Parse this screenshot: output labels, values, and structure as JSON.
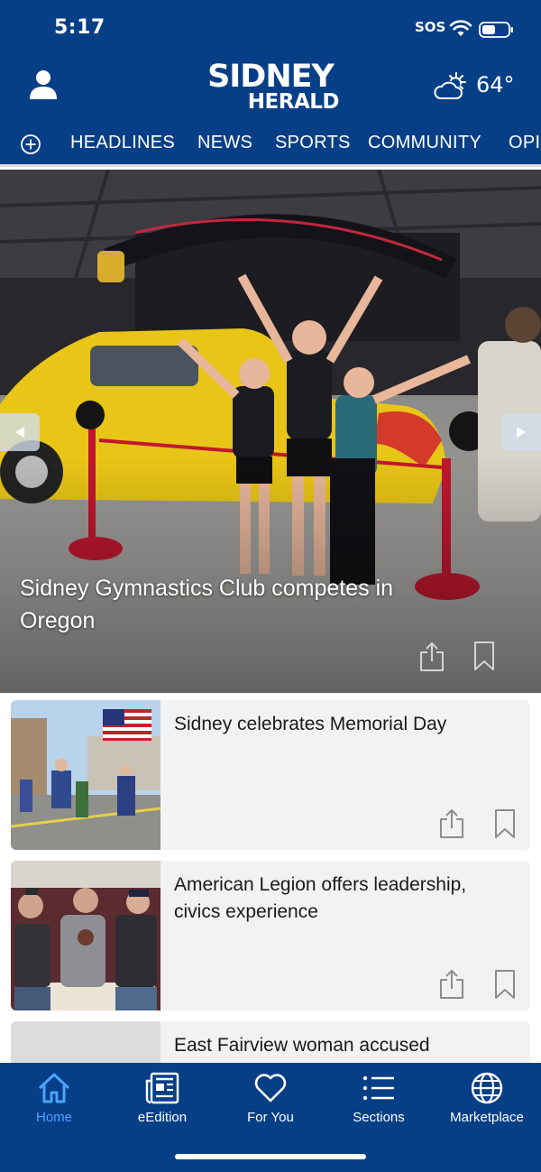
{
  "status_bar": {
    "time": "5:17",
    "carrier": "SOS"
  },
  "header": {
    "logo_line1": "SIDNEY",
    "logo_line2": "HERALD",
    "temperature": "64°",
    "weather_icon": "partly-cloudy-icon"
  },
  "nav": {
    "tabs": [
      "HEADLINES",
      "NEWS",
      "SPORTS",
      "COMMUNITY",
      "OPI"
    ]
  },
  "hero": {
    "title": "Sidney Gymnastics Club competes in Oregon"
  },
  "feed": [
    {
      "title": "Sidney celebrates Memorial Day"
    },
    {
      "title": "American Legion offers leadership, civics experience"
    },
    {
      "title": "East Fairview woman accused"
    }
  ],
  "tabbar": {
    "items": [
      {
        "label": "Home",
        "icon": "home-icon"
      },
      {
        "label": "eEdition",
        "icon": "newspaper-icon"
      },
      {
        "label": "For You",
        "icon": "heart-icon"
      },
      {
        "label": "Sections",
        "icon": "list-icon"
      },
      {
        "label": "Marketplace",
        "icon": "globe-icon"
      }
    ]
  },
  "colors": {
    "brand": "#073f87",
    "active_tab": "#4aa3ff",
    "card_bg": "#f2f2f2"
  }
}
